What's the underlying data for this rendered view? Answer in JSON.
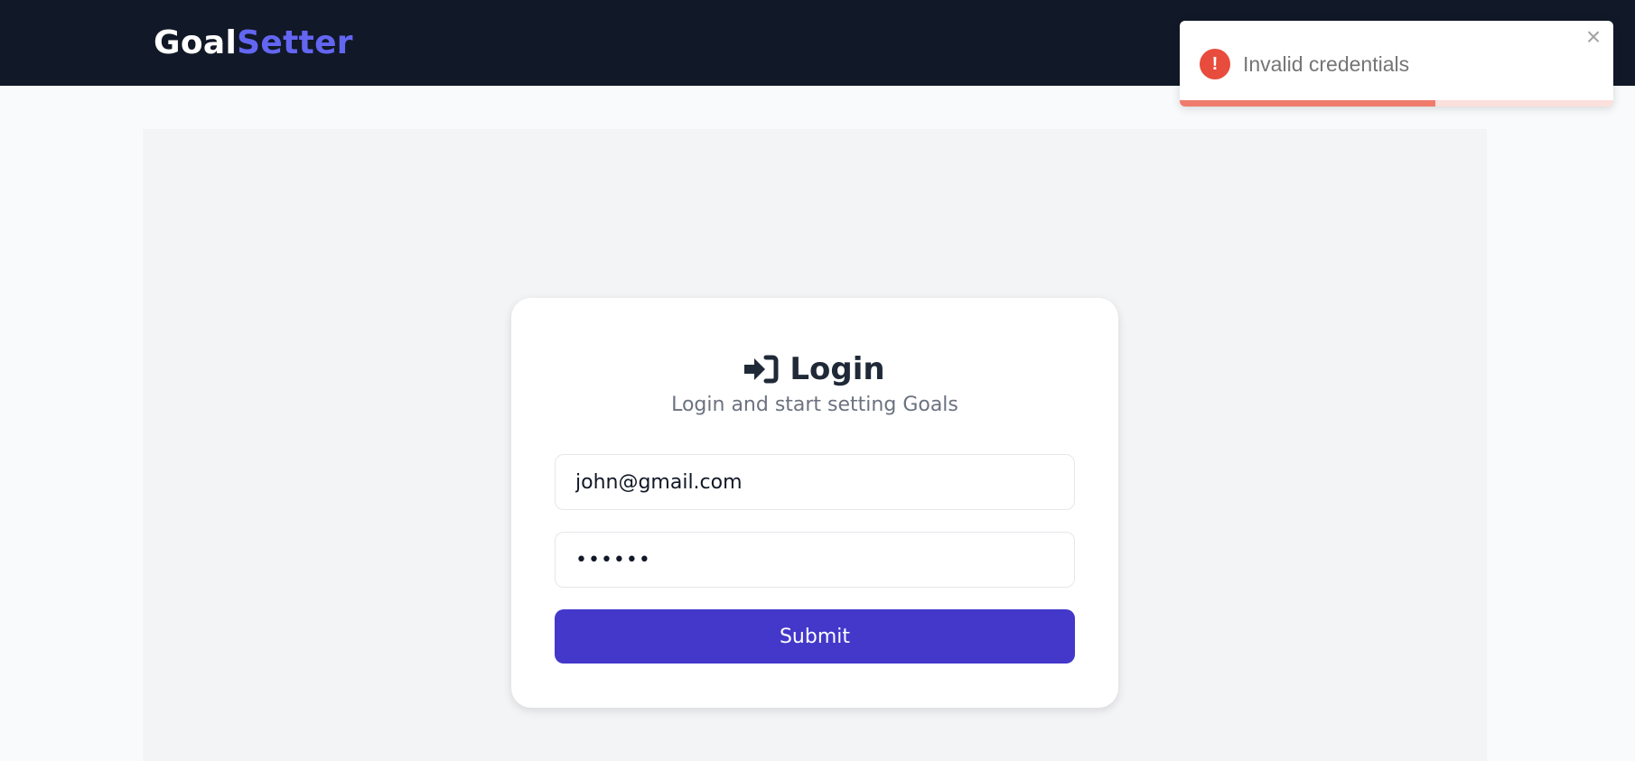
{
  "brand": {
    "part1": "Goal",
    "part2": "Setter"
  },
  "login": {
    "title": "Login",
    "subtitle": "Login and start setting Goals",
    "email_value": "john@gmail.com",
    "password_value": "••••••",
    "submit_label": "Submit"
  },
  "toast": {
    "message": "Invalid credentials",
    "icon_glyph": "!",
    "close_glyph": "×",
    "progress": 0.59,
    "type": "error"
  },
  "colors": {
    "navbar": "#111827",
    "brand_accent": "#6366f1",
    "submit": "#4338ca",
    "error": "#e74c3c"
  }
}
